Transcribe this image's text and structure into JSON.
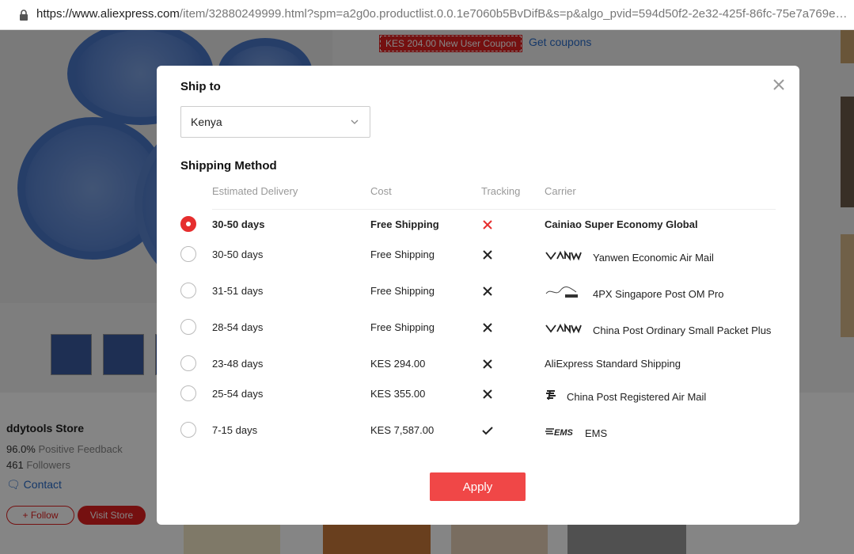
{
  "browser": {
    "url_host": "https://www.aliexpress.com",
    "url_rest": "/item/32880249999.html?spm=a2g0o.productlist.0.0.1e7060b5BvDifB&s=p&algo_pvid=594d50f2-2e32-425f-86fc-75e7a769e0..."
  },
  "background": {
    "coupon_text": "KES 204.00 New User Coupon",
    "get_coupons": "Get coupons",
    "store": {
      "name": "ddytools Store",
      "feedback_value": "96.0%",
      "feedback_label": "Positive Feedback",
      "followers_value": "461",
      "followers_label": "Followers",
      "contact": "Contact",
      "follow_button": "+ Follow",
      "visit_button": "Visit Store"
    }
  },
  "modal": {
    "ship_to_label": "Ship to",
    "country": "Kenya",
    "shipping_method_label": "Shipping Method",
    "columns": {
      "delivery": "Estimated Delivery",
      "cost": "Cost",
      "tracking": "Tracking",
      "carrier": "Carrier"
    },
    "rows": [
      {
        "delivery": "30-50 days",
        "cost": "Free Shipping",
        "tracking": "no",
        "carrier": "Cainiao Super Economy Global",
        "logo": "",
        "selected": true
      },
      {
        "delivery": "30-50 days",
        "cost": "Free Shipping",
        "tracking": "no",
        "carrier": "Yanwen Economic Air Mail",
        "logo": "yanwen-logo",
        "selected": false
      },
      {
        "delivery": "31-51 days",
        "cost": "Free Shipping",
        "tracking": "no",
        "carrier": "4PX Singapore Post OM Pro",
        "logo": "singapore-post-logo",
        "selected": false
      },
      {
        "delivery": "28-54 days",
        "cost": "Free Shipping",
        "tracking": "no",
        "carrier": "China Post Ordinary Small Packet Plus",
        "logo": "yanwen-logo",
        "selected": false
      },
      {
        "delivery": "23-48 days",
        "cost": "KES 294.00",
        "tracking": "no",
        "carrier": "AliExpress Standard Shipping",
        "logo": "",
        "selected": false
      },
      {
        "delivery": "25-54 days",
        "cost": "KES 355.00",
        "tracking": "no",
        "carrier": "China Post Registered Air Mail",
        "logo": "china-post-logo",
        "selected": false
      },
      {
        "delivery": "7-15 days",
        "cost": "KES 7,587.00",
        "tracking": "yes",
        "carrier": "EMS",
        "logo": "ems-logo",
        "selected": false
      }
    ],
    "apply_button": "Apply"
  },
  "colors": {
    "accent": "#f04747",
    "selected_radio": "#e62e2e",
    "link": "#2a6cc9",
    "tracking_no_selected": "#e62e2e"
  }
}
